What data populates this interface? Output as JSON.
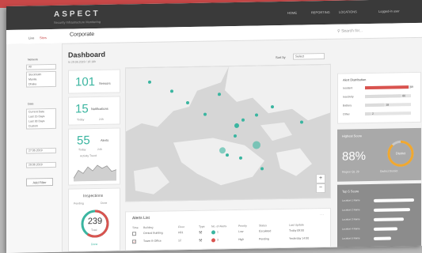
{
  "topbar": {
    "brand": "ASPECT",
    "brand_sub": "Security Infrastructure Monitoring",
    "nav": [
      "HOME",
      "REPORTING",
      "LOCATIONS",
      "Logged-in user"
    ]
  },
  "subbar": {
    "tabs": [
      "Live",
      "Sites"
    ],
    "section_title": "Corporate",
    "search_placeholder": "Search for..."
  },
  "sidebar": {
    "section1_label": "Network",
    "select1": "All",
    "list1": [
      "Stockholm",
      "Manila",
      "Dhaka"
    ],
    "section2_label": "Date",
    "list2": [
      "Current Date",
      "Last 15 Days",
      "Last 30 Days",
      "Custom"
    ],
    "date_from": "27.05.2019",
    "date_to": "29.06.2019",
    "add_filter": "Add Filter"
  },
  "header": {
    "title": "Dashboard",
    "subtitle": "In 29.06.2019 / 16:18h",
    "sort_label": "Sort by",
    "sort_value": "Select"
  },
  "cards": {
    "sensors": {
      "value": "101",
      "label": "Sensors"
    },
    "notifications": {
      "value": "15",
      "label": "Notifications",
      "sub1": "Today",
      "sub2": "24h"
    },
    "alerts": {
      "value": "55",
      "label": "Alerts",
      "sub1": "Today",
      "sub2": "24h",
      "sub3": "Activity Trend"
    },
    "inspections": {
      "title": "Inspections",
      "sub1": "Pending",
      "sub2": "Done",
      "value": "239",
      "value_label": "Total",
      "footer": "Done"
    }
  },
  "alert_distribution": {
    "title": "Alert Distribution",
    "rows": [
      {
        "label": "Incident",
        "value": "99",
        "fraction": 0.95,
        "color": "#d9534f"
      },
      {
        "label": "Inactivity",
        "value": "80",
        "fraction": 0.78,
        "color": "#dcdcdc"
      },
      {
        "label": "Battery",
        "value": "18",
        "fraction": 0.42,
        "color": "#dcdcdc"
      },
      {
        "label": "Other",
        "value": "2",
        "fraction": 0.12,
        "color": "#dcdcdc"
      }
    ]
  },
  "highest_score": {
    "title": "Highest Score",
    "value": "88%",
    "gauge_label": "District",
    "legend1": "Region Q1 29",
    "legend2": "District District"
  },
  "top5": {
    "title": "Top 5 Score",
    "items": [
      {
        "label": "Location 1 Name",
        "fraction": 0.95
      },
      {
        "label": "Location 2 Name",
        "fraction": 0.85
      },
      {
        "label": "Location 3 Name",
        "fraction": 0.7
      },
      {
        "label": "Location 4 Name",
        "fraction": 0.55
      },
      {
        "label": "Location 5 Name",
        "fraction": 0.4
      }
    ]
  },
  "alerts_list": {
    "title": "Alerts List",
    "headers": [
      "Time",
      "Building",
      "Floor",
      "Type",
      "No. of Alerts",
      "Priority",
      "Status",
      "Last Update"
    ],
    "rows": [
      {
        "time": "07:40",
        "building": "Central Building",
        "floor": "H01",
        "alerts": "1",
        "priority": "Low",
        "status": "Escalated",
        "update": "Today 09:00",
        "checked": false,
        "dot": "#3ab5a0"
      },
      {
        "time": "07:35",
        "building": "Tower B Office",
        "floor": "12",
        "alerts": "3",
        "priority": "High",
        "status": "Pending",
        "update": "Yesterday 14:00",
        "checked": true,
        "dot": "#d9534f"
      }
    ]
  },
  "colors": {
    "accent": "#3ab5a0",
    "danger": "#d9534f",
    "gauge": "#f0a830"
  }
}
